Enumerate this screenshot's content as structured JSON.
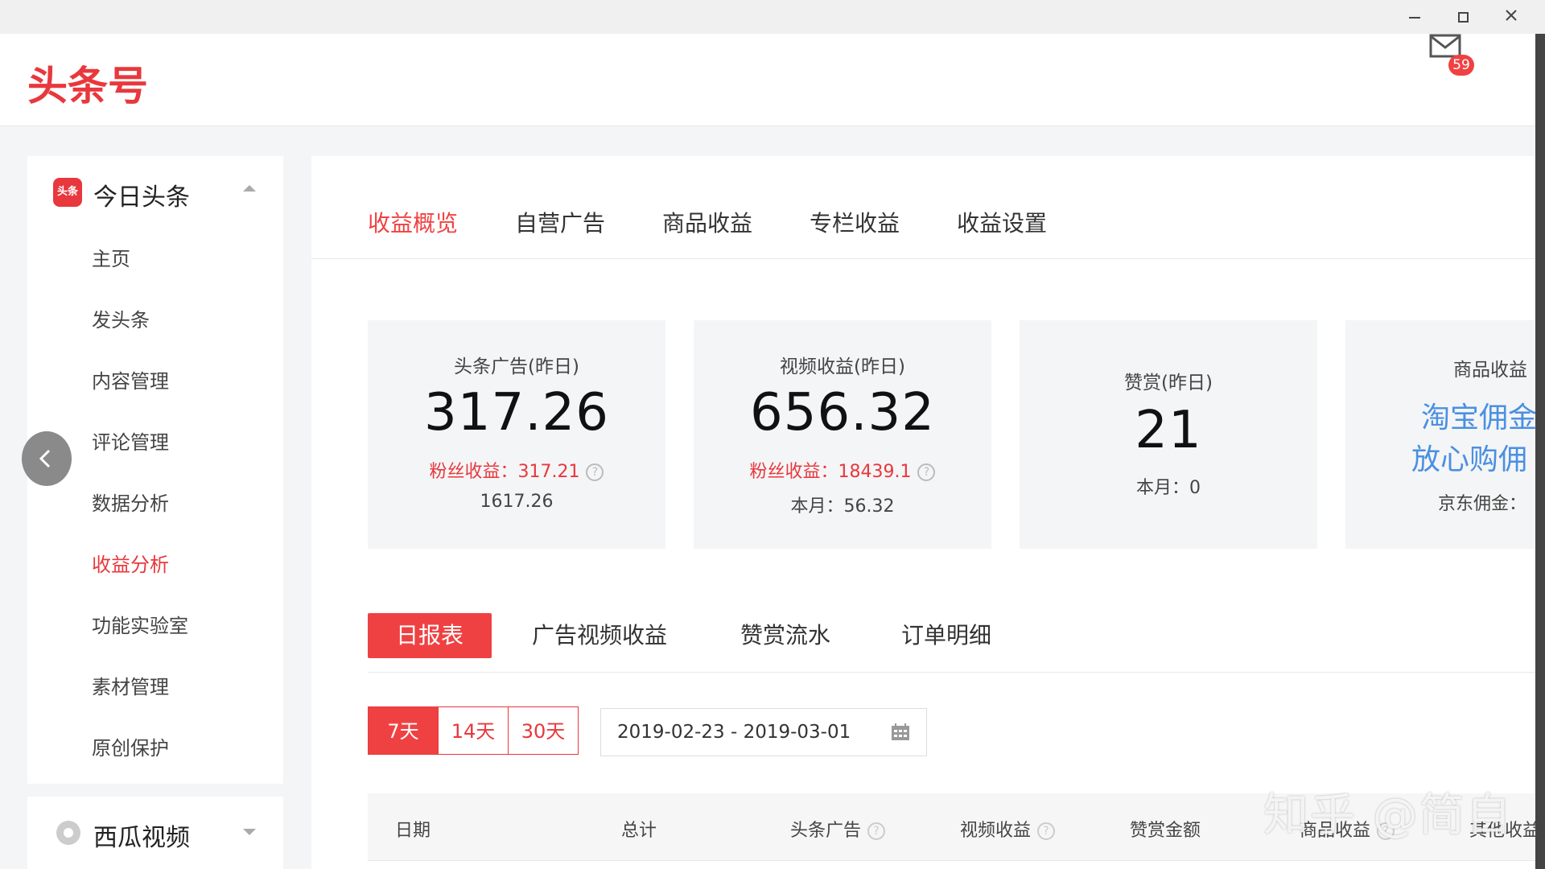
{
  "window": {
    "minimize_icon": "minimize-icon",
    "maximize_icon": "maximize-icon",
    "close_icon": "close-icon"
  },
  "header": {
    "logo": "头条号",
    "mail_icon": "mail-icon",
    "mail_badge": "59"
  },
  "sidebar": {
    "platform": {
      "label": "今日头条",
      "icon_text": "头条"
    },
    "items": [
      {
        "label": "主页"
      },
      {
        "label": "发头条"
      },
      {
        "label": "内容管理"
      },
      {
        "label": "评论管理"
      },
      {
        "label": "数据分析"
      },
      {
        "label": "收益分析",
        "active": true
      },
      {
        "label": "功能实验室"
      },
      {
        "label": "素材管理"
      },
      {
        "label": "原创保护"
      }
    ],
    "platform2": {
      "label": "西瓜视频"
    }
  },
  "main": {
    "tabs": [
      {
        "label": "收益概览",
        "active": true
      },
      {
        "label": "自营广告"
      },
      {
        "label": "商品收益"
      },
      {
        "label": "专栏收益"
      },
      {
        "label": "收益设置"
      }
    ],
    "stats": [
      {
        "title": "头条广告(昨日)",
        "value": "317.26",
        "fans": "粉丝收益：317.21",
        "sub": "1617.26"
      },
      {
        "title": "视频收益(昨日)",
        "value": "656.32",
        "fans": "粉丝收益：18439.1",
        "sub": "本月：56.32"
      },
      {
        "title": "赞赏(昨日)",
        "value": "21",
        "sub": "本月：0"
      }
    ],
    "goods": {
      "title": "商品收益",
      "link1": "淘宝佣金",
      "link2": "放心购佣",
      "sub": "京东佣金："
    },
    "sub_tabs": [
      {
        "label": "日报表",
        "active": true
      },
      {
        "label": "广告视频收益"
      },
      {
        "label": "赞赏流水"
      },
      {
        "label": "订单明细"
      }
    ],
    "ranges": [
      {
        "label": "7天",
        "active": true
      },
      {
        "label": "14天"
      },
      {
        "label": "30天"
      }
    ],
    "date_range": "2019-02-23  -  2019-03-01",
    "calendar_icon": "calendar-icon",
    "table_headers": [
      "日期",
      "总计",
      "头条广告",
      "视频收益",
      "赞赏金额",
      "商品收益",
      "其他收益"
    ],
    "help_glyph": "?"
  },
  "watermark": "知乎 @简自"
}
